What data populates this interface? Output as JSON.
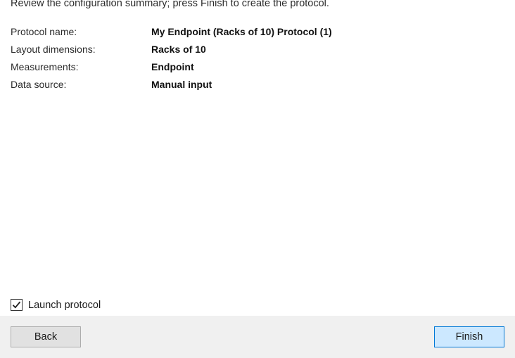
{
  "intro": "Review the configuration summary; press Finish to create the protocol.",
  "summary": [
    {
      "label": "Protocol name:",
      "value": "My Endpoint (Racks of 10) Protocol (1)"
    },
    {
      "label": "Layout dimensions:",
      "value": "Racks of 10"
    },
    {
      "label": "Measurements:",
      "value": "Endpoint"
    },
    {
      "label": "Data source:",
      "value": "Manual input"
    }
  ],
  "launch": {
    "label": "Launch protocol",
    "checked": true
  },
  "buttons": {
    "back": "Back",
    "finish": "Finish"
  },
  "colors": {
    "footer_bg": "#f0f0f0",
    "finish_bg": "#cce8ff",
    "finish_border": "#0078d7",
    "back_bg": "#e1e1e1"
  }
}
